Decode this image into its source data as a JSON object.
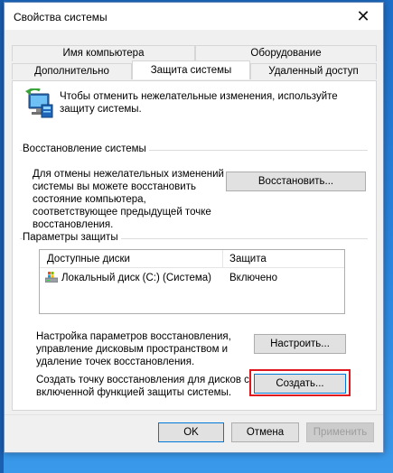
{
  "window": {
    "title": "Свойства системы",
    "close_glyph": "✕"
  },
  "tabs": {
    "top_row": [
      "Имя компьютера",
      "Оборудование"
    ],
    "bottom_row": [
      "Дополнительно",
      "Защита системы",
      "Удаленный доступ"
    ],
    "active": "Защита системы"
  },
  "intro": {
    "icon": "system-protection-icon",
    "text_line1": "Чтобы отменить нежелательные изменения, используйте",
    "text_line2": "защиту системы."
  },
  "restore": {
    "group_title": "Восстановление системы",
    "desc_lines": [
      "Для отмены нежелательных изменений",
      "системы вы можете восстановить",
      "состояние компьютера,",
      "соответствующее предыдущей точке",
      "восстановления."
    ],
    "button": "Восстановить..."
  },
  "protection": {
    "group_title": "Параметры защиты",
    "columns": [
      "Доступные диски",
      "Защита"
    ],
    "rows": [
      {
        "drive": "Локальный диск (C:) (Система)",
        "status": "Включено",
        "icon": "drive-icon"
      }
    ],
    "configure_lines": [
      "Настройка параметров восстановления,",
      "управление дисковым пространством и",
      "удаление точек восстановления."
    ],
    "configure_button": "Настроить...",
    "create_lines": [
      "Создать точку восстановления для дисков с",
      "включенной функцией защиты системы."
    ],
    "create_button": "Создать..."
  },
  "footer": {
    "ok": "OK",
    "cancel": "Отмена",
    "apply": "Применить"
  },
  "colors": {
    "highlight": "#e0161e",
    "focus": "#0078d7",
    "desktop": "#2a86e0"
  }
}
